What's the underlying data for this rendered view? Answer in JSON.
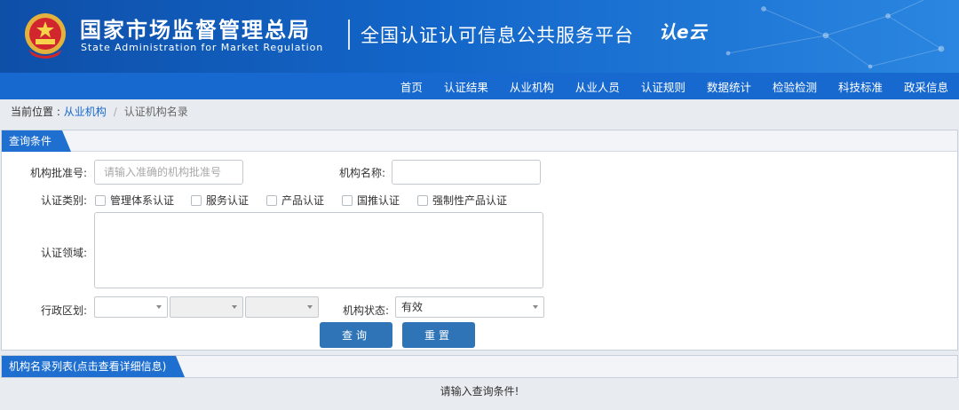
{
  "header": {
    "org_name_cn": "国家市场监督管理总局",
    "org_name_en": "State Administration  for  Market Regulation",
    "platform_title": "全国认证认可信息公共服务平台",
    "logo_text": "认e云",
    "brand_color": "#1768cf"
  },
  "nav": {
    "items": [
      "首页",
      "认证结果",
      "从业机构",
      "从业人员",
      "认证规则",
      "数据统计",
      "检验检测",
      "科技标准",
      "政采信息"
    ]
  },
  "breadcrumb": {
    "prefix": "当前位置 : ",
    "link": "从业机构",
    "separator": "/",
    "current": "认证机构名录"
  },
  "query": {
    "title": "查询条件",
    "approval_no_label": "机构批准号:",
    "approval_no_placeholder": "请输入准确的机构批准号",
    "approval_no_value": "",
    "org_name_label": "机构名称:",
    "org_name_value": "",
    "cert_type_label": "认证类别:",
    "cert_types": [
      "管理体系认证",
      "服务认证",
      "产品认证",
      "国推认证",
      "强制性产品认证"
    ],
    "field_label": "认证领域:",
    "region_label": "行政区划:",
    "status_label": "机构状态:",
    "status_value": "有效",
    "search_label": "查询",
    "reset_label": "重置"
  },
  "results": {
    "title": "机构名录列表(点击查看详细信息)",
    "empty_message": "请输入查询条件!"
  }
}
